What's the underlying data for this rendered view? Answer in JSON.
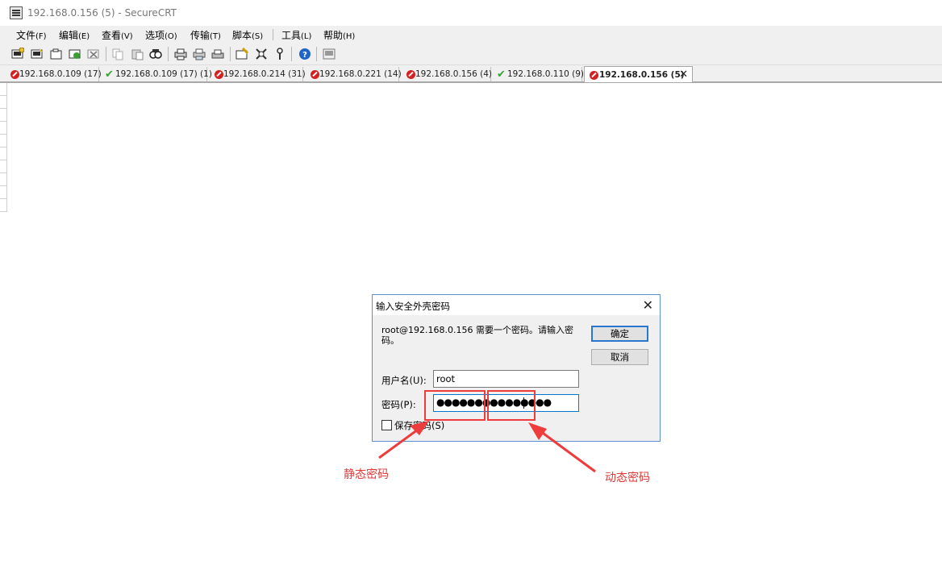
{
  "window": {
    "title": "192.168.0.156 (5) - SecureCRT"
  },
  "menu": {
    "items": [
      {
        "label": "文件",
        "accel": "(F)"
      },
      {
        "label": "编辑",
        "accel": "(E)"
      },
      {
        "label": "查看",
        "accel": "(V)"
      },
      {
        "label": "选项",
        "accel": "(O)"
      },
      {
        "label": "传输",
        "accel": "(T)"
      },
      {
        "label": "脚本",
        "accel": "(S)"
      },
      {
        "label": "工具",
        "accel": "(L)"
      },
      {
        "label": "帮助",
        "accel": "(H)"
      }
    ]
  },
  "toolbar": {
    "icons": [
      "connect-icon",
      "quick-connect-icon",
      "connect-tab-icon",
      "reconnect-icon",
      "disconnect-icon",
      "copy-icon",
      "paste-icon",
      "find-icon",
      "print-icon",
      "print-selection-icon",
      "print-setup-icon",
      "session-options-icon",
      "global-options-icon",
      "keymap-icon",
      "help-icon",
      "sftp-icon"
    ]
  },
  "tabs": [
    {
      "label": "192.168.0.109 (17)",
      "status": "disconnected"
    },
    {
      "label": "192.168.0.109 (17) (1)",
      "status": "connected"
    },
    {
      "label": "192.168.0.214 (31)",
      "status": "disconnected"
    },
    {
      "label": "192.168.0.221 (14)",
      "status": "disconnected"
    },
    {
      "label": "192.168.0.156 (4)",
      "status": "disconnected"
    },
    {
      "label": "192.168.0.110 (9)",
      "status": "connected"
    },
    {
      "label": "192.168.0.156 (5)",
      "status": "disconnected",
      "active": true
    }
  ],
  "dialog": {
    "title": "输入安全外壳密码",
    "message": "root@192.168.0.156 需要一个密码。请输入密码。",
    "ok_label": "确定",
    "cancel_label": "取消",
    "username_label": "用户名(U):",
    "username_value": "root",
    "password_label": "密码(P):",
    "password_mask": "●●●●●●●●●●●●●●●",
    "save_password_label": "保存密码(S)",
    "save_password_checked": false
  },
  "annotations": {
    "static_password": "静态密码",
    "dynamic_password": "动态密码"
  },
  "colors": {
    "annotation_red": "#e03a3a",
    "dialog_border": "#5b8fd0",
    "status_connected": "#3aa035",
    "status_disconnected": "#d42020"
  }
}
